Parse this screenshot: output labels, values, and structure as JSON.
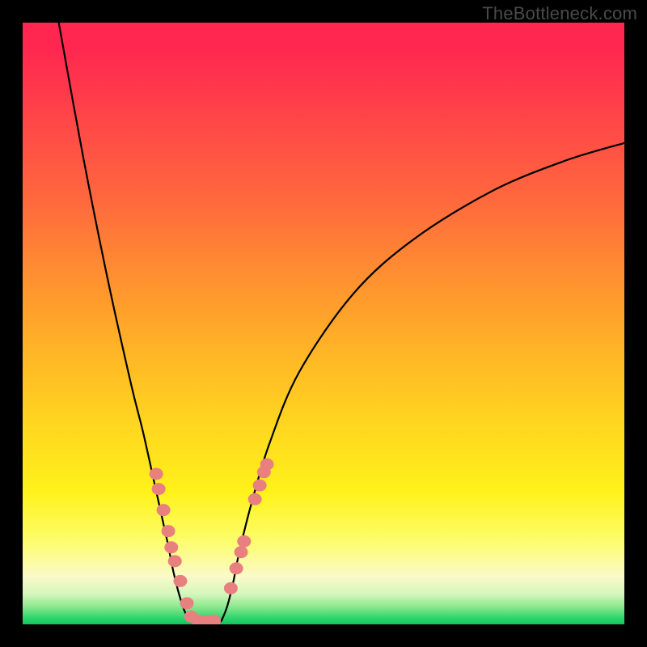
{
  "watermark": "TheBottleneck.com",
  "chart_data": {
    "type": "line",
    "title": "",
    "xlabel": "",
    "ylabel": "",
    "xlim": [
      0,
      100
    ],
    "ylim": [
      0,
      100
    ],
    "series": [
      {
        "name": "curve-left",
        "x": [
          6,
          10,
          14,
          18,
          20,
          22,
          24,
          25,
          26,
          27,
          28
        ],
        "y": [
          100,
          78,
          58,
          40,
          32,
          23,
          14,
          9,
          5,
          2,
          0.5
        ]
      },
      {
        "name": "curve-right",
        "x": [
          33,
          34,
          35,
          36,
          38,
          41,
          46,
          55,
          65,
          78,
          90,
          100
        ],
        "y": [
          0.5,
          3,
          7,
          12,
          20,
          30,
          42,
          55,
          64,
          72,
          77,
          80
        ]
      },
      {
        "name": "curve-bottom",
        "x": [
          28,
          29,
          30,
          31,
          32,
          33
        ],
        "y": [
          0.5,
          0.3,
          0.2,
          0.2,
          0.3,
          0.5
        ]
      }
    ],
    "markers_left": [
      {
        "x": 22.2,
        "y": 25.0
      },
      {
        "x": 22.6,
        "y": 22.5
      },
      {
        "x": 23.4,
        "y": 19.0
      },
      {
        "x": 24.2,
        "y": 15.5
      },
      {
        "x": 24.7,
        "y": 12.8
      },
      {
        "x": 25.3,
        "y": 10.5
      },
      {
        "x": 26.2,
        "y": 7.2
      },
      {
        "x": 27.3,
        "y": 3.5
      },
      {
        "x": 28.0,
        "y": 1.3
      },
      {
        "x": 29.2,
        "y": 0.6
      },
      {
        "x": 30.6,
        "y": 0.5
      },
      {
        "x": 31.8,
        "y": 0.6
      }
    ],
    "markers_right": [
      {
        "x": 34.6,
        "y": 6.0
      },
      {
        "x": 35.5,
        "y": 9.3
      },
      {
        "x": 36.3,
        "y": 12.0
      },
      {
        "x": 36.8,
        "y": 13.8
      },
      {
        "x": 38.6,
        "y": 20.8
      },
      {
        "x": 39.4,
        "y": 23.1
      },
      {
        "x": 40.1,
        "y": 25.3
      },
      {
        "x": 40.6,
        "y": 26.6
      }
    ],
    "marker_color": "#e98080",
    "curve_color": "#000000"
  }
}
